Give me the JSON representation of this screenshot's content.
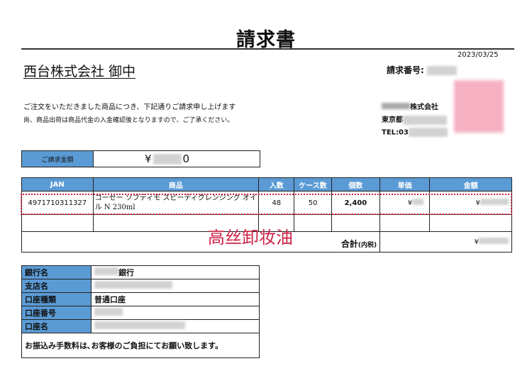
{
  "title": "請求書",
  "date": "2023/03/25",
  "recipient": "西台株式会社 御中",
  "invoice_no_label": "請求番号:",
  "intro_line1": "ご注文をいただきました商品につき、下記通りご請求申し上げます",
  "intro_line2": "尚、商品出荷は商品代金の入金確認後となりますので、ご了承ください。",
  "issuer": {
    "company_suffix": "株式会社",
    "address_prefix": "東京都",
    "tel_prefix": "TEL:03"
  },
  "amount_label": "ご請求金額",
  "amount_prefix": "¥",
  "amount_suffix": "0",
  "table": {
    "headers": [
      "JAN",
      "商品",
      "入数",
      "ケース数",
      "個数",
      "単価",
      "金額"
    ],
    "row": {
      "jan": "4971710311327",
      "product": "コーセー ソフティモ スピーディクレンジング オイル N 230ml",
      "irisu": "48",
      "cases": "50",
      "qty": "2,400",
      "unit_price_prefix": "¥",
      "amount_prefix": "¥"
    },
    "total_label": "合計",
    "total_note": "(内税)",
    "total_prefix": "¥"
  },
  "annotation": "高丝卸妆油",
  "bank": {
    "bank_name_label": "銀行名",
    "bank_name_suffix": "銀行",
    "branch_label": "支店名",
    "account_type_label": "口座種類",
    "account_type_value": "普通口座",
    "account_no_label": "口座番号",
    "account_name_label": "口座名",
    "note": "お振込み手数料は､お客様のご負担にてお願い致します。"
  },
  "colors": {
    "header_blue": "#5b9bd5",
    "annotation_red": "#cc2244",
    "stamp_pink": "#f4a9bc"
  }
}
